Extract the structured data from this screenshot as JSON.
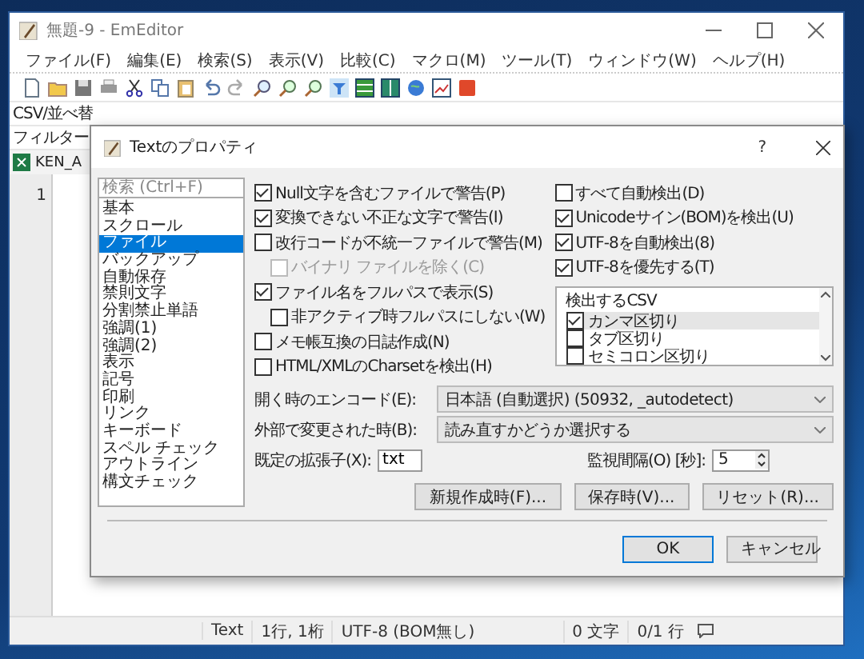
{
  "window": {
    "title": "無題-9 - EmEditor"
  },
  "menu": [
    "ファイル(F)",
    "編集(E)",
    "検索(S)",
    "表示(V)",
    "比較(C)",
    "マクロ(M)",
    "ツール(T)",
    "ウィンドウ(W)",
    "ヘルプ(H)"
  ],
  "csv_toolbar": {
    "label": "CSV/並べ替"
  },
  "filter_bar": {
    "label": "フィルター"
  },
  "document_tab": {
    "label": "KEN_A"
  },
  "editor": {
    "line_numbers": [
      "1"
    ]
  },
  "status_bar": [
    "Text",
    "1行, 1桁",
    "UTF-8 (BOM無し)",
    "0 文字",
    "0/1 行"
  ],
  "dialog": {
    "title": "Textのプロパティ",
    "help": "?",
    "search": {
      "placeholder": "検索 (Ctrl+F)"
    },
    "categories": [
      {
        "label": "基本",
        "selected": false
      },
      {
        "label": "スクロール",
        "selected": false
      },
      {
        "label": "ファイル",
        "selected": true
      },
      {
        "label": "バックアップ",
        "selected": false
      },
      {
        "label": "自動保存",
        "selected": false
      },
      {
        "label": "禁則文字",
        "selected": false
      },
      {
        "label": "分割禁止単語",
        "selected": false
      },
      {
        "label": "強調(1)",
        "selected": false
      },
      {
        "label": "強調(2)",
        "selected": false
      },
      {
        "label": "表示",
        "selected": false
      },
      {
        "label": "記号",
        "selected": false
      },
      {
        "label": "印刷",
        "selected": false
      },
      {
        "label": "リンク",
        "selected": false
      },
      {
        "label": "キーボード",
        "selected": false
      },
      {
        "label": "スペル チェック",
        "selected": false
      },
      {
        "label": "アウトライン",
        "selected": false
      },
      {
        "label": "構文チェック",
        "selected": false
      }
    ],
    "options_left": [
      {
        "label": "Null文字を含むファイルで警告(P)",
        "checked": true,
        "disabled": false
      },
      {
        "label": "変換できない不正な文字で警告(I)",
        "checked": true,
        "disabled": false
      },
      {
        "label": "改行コードが不統一ファイルで警告(M)",
        "checked": false,
        "disabled": false,
        "children": [
          {
            "label": "バイナリ ファイルを除く(C)",
            "checked": false,
            "disabled": true
          }
        ]
      },
      {
        "label": "ファイル名をフルパスで表示(S)",
        "checked": true,
        "disabled": false,
        "children": [
          {
            "label": "非アクティブ時フルパスにしない(W)",
            "checked": false,
            "disabled": false
          }
        ]
      },
      {
        "label": "メモ帳互換の日誌作成(N)",
        "checked": false,
        "disabled": false
      },
      {
        "label": "HTML/XMLのCharsetを検出(H)",
        "checked": false,
        "disabled": false
      }
    ],
    "options_right": [
      {
        "label": "すべて自動検出(D)",
        "checked": false,
        "disabled": false
      },
      {
        "label": "Unicodeサイン(BOM)を検出(U)",
        "checked": true,
        "disabled": false
      },
      {
        "label": "UTF-8を自動検出(8)",
        "checked": true,
        "disabled": false
      },
      {
        "label": "UTF-8を優先する(T)",
        "checked": true,
        "disabled": false
      }
    ],
    "csv_list": {
      "title": "検出するCSV",
      "items": [
        {
          "label": "カンマ区切り",
          "checked": true,
          "selected": true
        },
        {
          "label": "タブ区切り",
          "checked": false,
          "selected": false
        },
        {
          "label": "セミコロン区切り",
          "checked": false,
          "selected": false
        }
      ]
    },
    "encoding": {
      "label": "開く時のエンコード(E):",
      "value": "日本語 (自動選択) (50932, _autodetect)"
    },
    "on_external_change": {
      "label": "外部で変更された時(B):",
      "value": "読み直すかどうか選択する"
    },
    "default_extension": {
      "label": "既定の拡張子(X):",
      "value": "txt"
    },
    "watch_interval": {
      "label": "監視間隔(O) [秒]:",
      "value": "5"
    },
    "action_buttons": [
      "新規作成時(F)...",
      "保存時(V)...",
      "リセット(R)..."
    ],
    "ok_button": "OK",
    "cancel_button": "キャンセル"
  }
}
